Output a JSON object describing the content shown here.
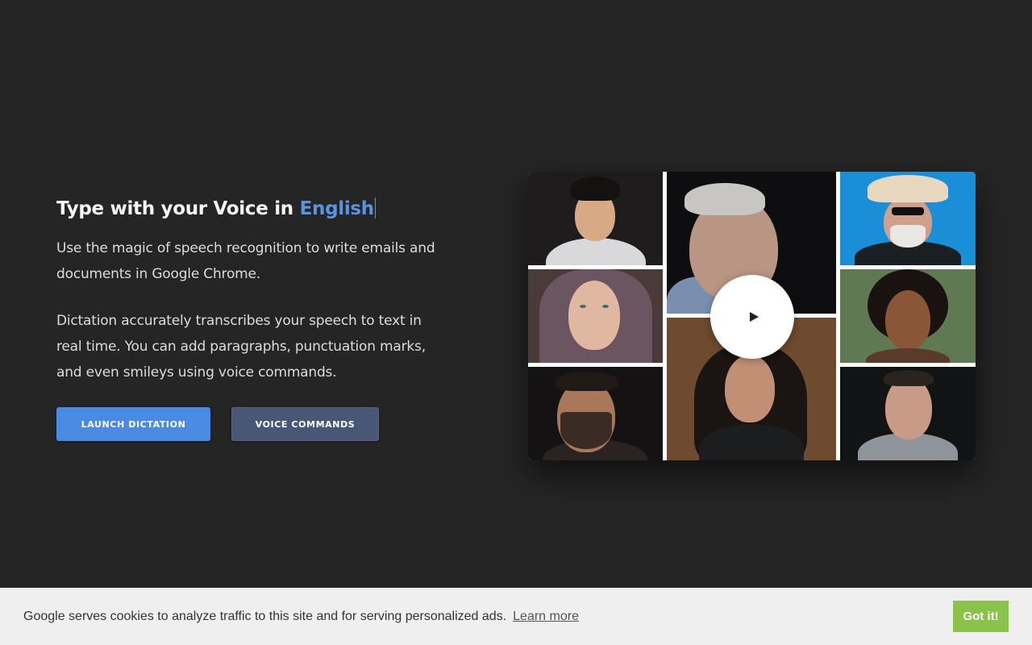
{
  "hero": {
    "headline_prefix": "Type with your Voice in ",
    "headline_language": "English",
    "paragraph1": "Use the magic of speech recognition to write emails and documents in Google Chrome.",
    "paragraph2": "Dictation accurately transcribes your speech to text in real time. You can add paragraphs, punctuation marks, and even smileys using voice commands."
  },
  "buttons": {
    "launch_label": "LAUNCH DICTATION",
    "commands_label": "VOICE COMMANDS"
  },
  "video": {
    "play_icon": "play-icon"
  },
  "cookie": {
    "message": "Google serves cookies to analyze traffic to this site and for serving personalized ads.",
    "learn_more": "Learn more",
    "accept_label": "Got it!"
  },
  "colors": {
    "background": "#252526",
    "accent": "#4a8ae2",
    "secondary_button": "#475775",
    "cookie_accept": "#8bc34a",
    "cookie_bar": "#efefef"
  }
}
